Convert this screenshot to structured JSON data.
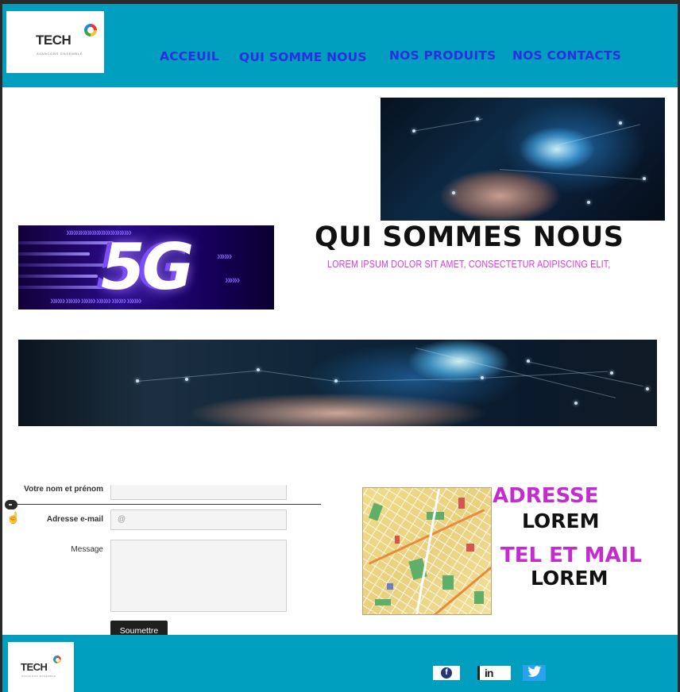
{
  "header": {
    "logo": {
      "brand": "TECH",
      "tagline": "AVANCONS ENSEMBLE"
    },
    "nav": [
      {
        "label": "ACCEUIL"
      },
      {
        "label": "QUI SOMME NOUS"
      },
      {
        "label": "NOS PRODUITS"
      },
      {
        "label": "NOS CONTACTS"
      }
    ]
  },
  "about": {
    "title": "QUI SOMMES NOUS",
    "text": "LOREM IPSUM DOLOR SIT AMET, CONSECTETUR ADIPISCING ELIT,",
    "badge_text": "5G"
  },
  "form": {
    "name_label": "Votre nom et prénom",
    "email_label": "Adresse e-mail",
    "email_placeholder": "@",
    "message_label": "Message",
    "submit_label": "Soumettre"
  },
  "contact": {
    "address_heading": "ADRESSE",
    "address_value": "LOREM",
    "tel_heading": "TEL ET MAIL",
    "tel_value": "LOREM"
  },
  "footer": {
    "logo": {
      "brand": "TECH",
      "tagline": "AVANCONS ENSEMBLE"
    },
    "social": [
      {
        "name": "facebook",
        "glyph": "f"
      },
      {
        "name": "linkedin",
        "glyph": "in"
      },
      {
        "name": "twitter",
        "glyph": "🐦"
      }
    ]
  },
  "colors": {
    "header_bg": "#009fbf",
    "nav_text": "#2d2ee0",
    "accent_pink": "#c42cd0"
  }
}
